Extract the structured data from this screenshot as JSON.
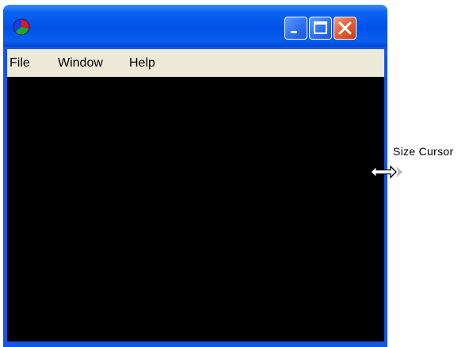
{
  "window": {
    "app_icon": "tricolor-pie-icon",
    "controls": {
      "minimize_icon": "minimize-icon",
      "maximize_icon": "maximize-icon",
      "close_icon": "close-icon"
    }
  },
  "menu": {
    "items": [
      "File",
      "Window",
      "Help"
    ]
  },
  "annotation": {
    "label": "Size Cursor",
    "icon": "size-cursor-icon"
  },
  "colors": {
    "titlebar": "#0050e6",
    "window_border": "#1654e2",
    "menubar": "#ece9d8",
    "client_area": "#000000",
    "close_button": "#e15a2e"
  }
}
